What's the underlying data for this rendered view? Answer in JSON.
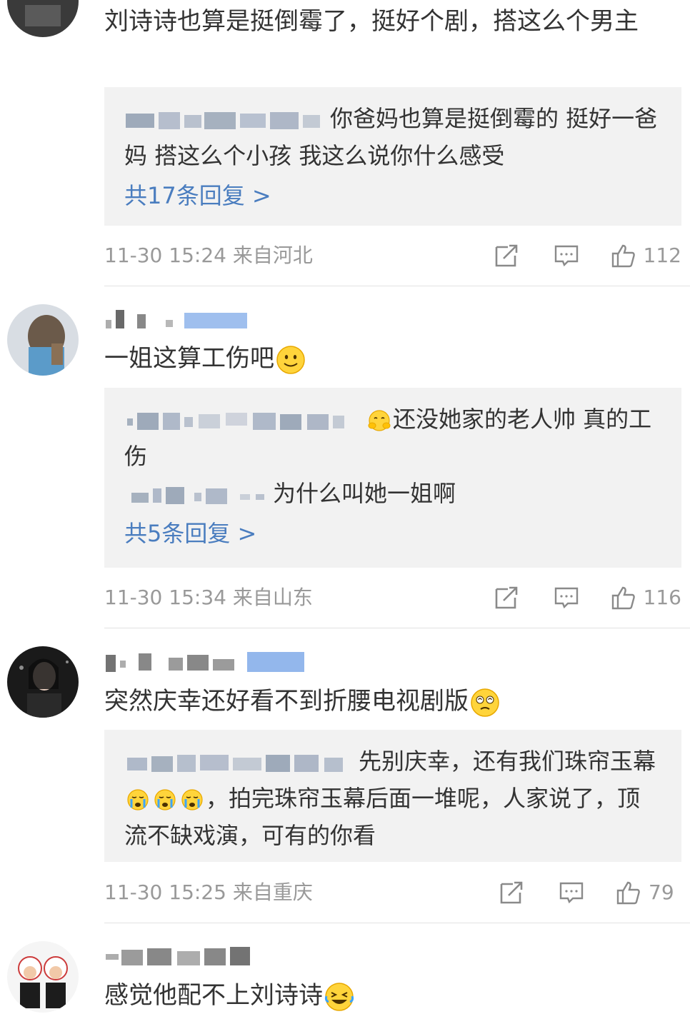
{
  "comments": [
    {
      "text": "刘诗诗也算是挺倒霉了，挺好个剧，搭这么个男主",
      "replies": [
        {
          "text": "你爸妈也算是挺倒霉的 挺好一爸妈 搭这么个小孩 我这么说你什么感受"
        }
      ],
      "reply_count": "共17条回复 >",
      "time": "11-30 15:24",
      "location": "来自河北",
      "likes": "112"
    },
    {
      "text": "一姐这算工伤吧",
      "replies": [
        {
          "text": "还没她家的老人帅 真的工伤"
        },
        {
          "text": "为什么叫她一姐啊"
        }
      ],
      "reply_count": "共5条回复 >",
      "time": "11-30 15:34",
      "location": "来自山东",
      "likes": "116"
    },
    {
      "text": "突然庆幸还好看不到折腰电视剧版",
      "replies": [
        {
          "text_a": "先别庆幸，还有我们珠帘玉幕",
          "text_b": "，拍完珠帘玉幕后面一堆呢，人家说了，顶流不缺戏演，可有的你看"
        }
      ],
      "time": "11-30 15:25",
      "location": "来自重庆",
      "likes": "79"
    },
    {
      "text": "感觉他配不上刘诗诗"
    }
  ],
  "icons": {
    "repost": "repost-icon",
    "comment": "comment-icon",
    "like": "like-icon"
  },
  "colors": {
    "link": "#4a7dbf",
    "meta": "#999999",
    "reply_bg": "#f2f2f2"
  }
}
